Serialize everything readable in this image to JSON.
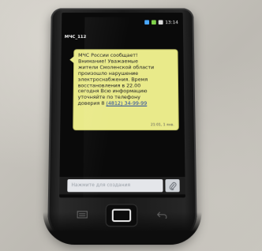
{
  "status_bar": {
    "clock": "13:14"
  },
  "conversation": {
    "title": "МЧС_112"
  },
  "message": {
    "text": "МЧС России сообщает!\nВнимание! Уважаемые\nжители Смоленской области\nпроизошло нарушение\nэлектроснабжения. Время\nвосстановления в 22.00\nсегодня Всю информацию\nуточняйте по телефону\nдоверия 8",
    "phone": "(4812) 34-99-99",
    "time": "21:01, 1 янв."
  },
  "compose": {
    "placeholder": "Нажмите для создания"
  },
  "icons": {
    "attach": "paperclip-icon",
    "home": "home-key-icon",
    "menu": "menu-key-icon",
    "back": "back-key-icon"
  }
}
